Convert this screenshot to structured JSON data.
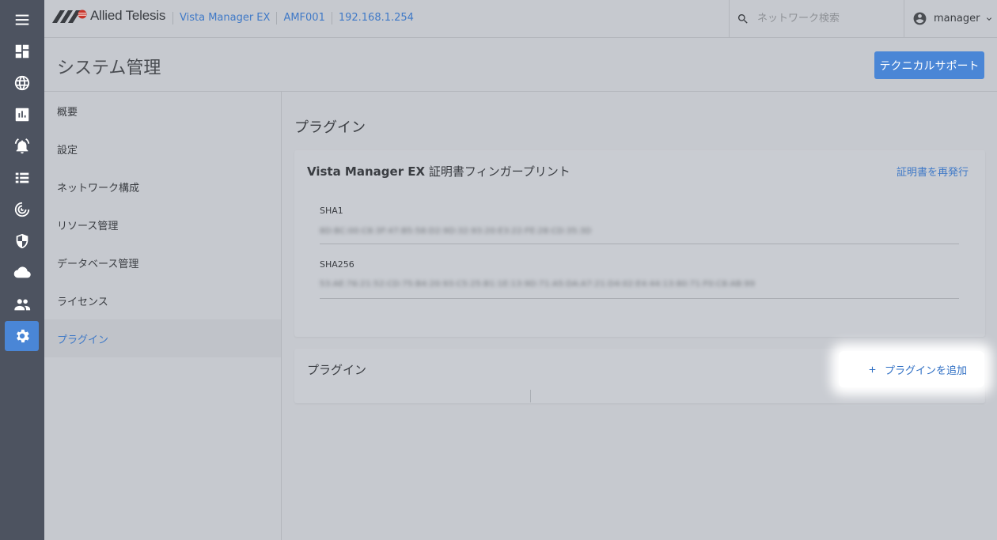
{
  "brand": {
    "logo_text": "Allied Telesis",
    "accent_color": "#4a86d6"
  },
  "breadcrumbs": [
    "Vista Manager EX",
    "AMF001",
    "192.168.1.254"
  ],
  "search": {
    "placeholder": "ネットワーク検索",
    "icon": "search-icon"
  },
  "user": {
    "name": "manager",
    "icon": "account-circle-icon"
  },
  "rail": {
    "items": [
      {
        "icon": "menu-icon"
      },
      {
        "icon": "dashboard-icon"
      },
      {
        "icon": "globe-icon"
      },
      {
        "icon": "chart-icon"
      },
      {
        "icon": "alarm-icon"
      },
      {
        "icon": "list-icon"
      },
      {
        "icon": "radar-icon"
      },
      {
        "icon": "shield-icon"
      },
      {
        "icon": "cloud-icon"
      },
      {
        "icon": "users-icon"
      },
      {
        "icon": "gear-icon",
        "active": true
      }
    ]
  },
  "page": {
    "title": "システム管理",
    "support_button": "テクニカルサポート"
  },
  "subnav": {
    "items": [
      {
        "label": "概要"
      },
      {
        "label": "設定"
      },
      {
        "label": "ネットワーク構成"
      },
      {
        "label": "リソース管理"
      },
      {
        "label": "データベース管理"
      },
      {
        "label": "ライセンス"
      },
      {
        "label": "プラグイン",
        "active": true
      }
    ]
  },
  "main": {
    "section_title": "プラグイン",
    "cert_card": {
      "title_bold": "Vista Manager EX",
      "title_rest": " 証明書フィンガープリント",
      "reissue_link": "証明書を再発行",
      "sha1_label": "SHA1",
      "sha1_value": "8D:BC:00:C8:3F:47:B5:58:D2:9D:32:93:20:E3:22:FE:28:CD:35:3D",
      "sha256_label": "SHA256",
      "sha256_value": "53:AE:76:21:52:CD:75:B4:20:93:C5:25:B1:1E:13:9D:71:A5:DA:A7:21:D4:02:E4:44:13:80:71:F0:C8:AB:99"
    },
    "plugin_card": {
      "title": "プラグイン",
      "add_button": "プラグインを追加"
    }
  }
}
